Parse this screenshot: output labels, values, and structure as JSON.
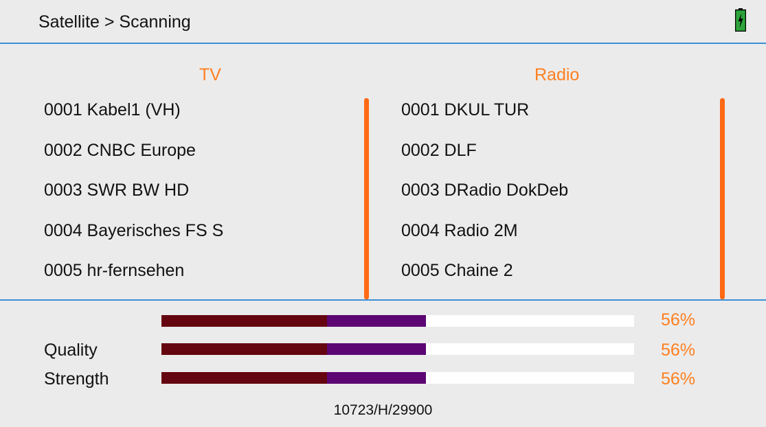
{
  "header": {
    "title": "Satellite > Scanning",
    "battery_icon": "battery-charging-icon",
    "battery_color": "#2ea43a"
  },
  "columns": {
    "tv": {
      "title": "TV",
      "items": [
        "0001 Kabel1 (VH)",
        "0002 CNBC Europe",
        "0003 SWR BW HD",
        "0004 Bayerisches FS S",
        "0005 hr-fernsehen"
      ]
    },
    "radio": {
      "title": "Radio",
      "items": [
        "0001 DKUL TUR",
        "0002 DLF",
        "0003 DRadio DokDeb",
        "0004 Radio 2M",
        "0005 Chaine 2"
      ]
    }
  },
  "meters": [
    {
      "label": "",
      "percent_text": "56%",
      "value": 0.56
    },
    {
      "label": "Quality",
      "percent_text": "56%",
      "value": 0.56
    },
    {
      "label": "Strength",
      "percent_text": "56%",
      "value": 0.56
    }
  ],
  "frequency": "10723/H/29900",
  "colors": {
    "accent": "#ff7f1f",
    "divider": "#3b8fd6",
    "bar_low": "#650510",
    "bar_high": "#5c0573",
    "bar_track": "#ffffff"
  }
}
